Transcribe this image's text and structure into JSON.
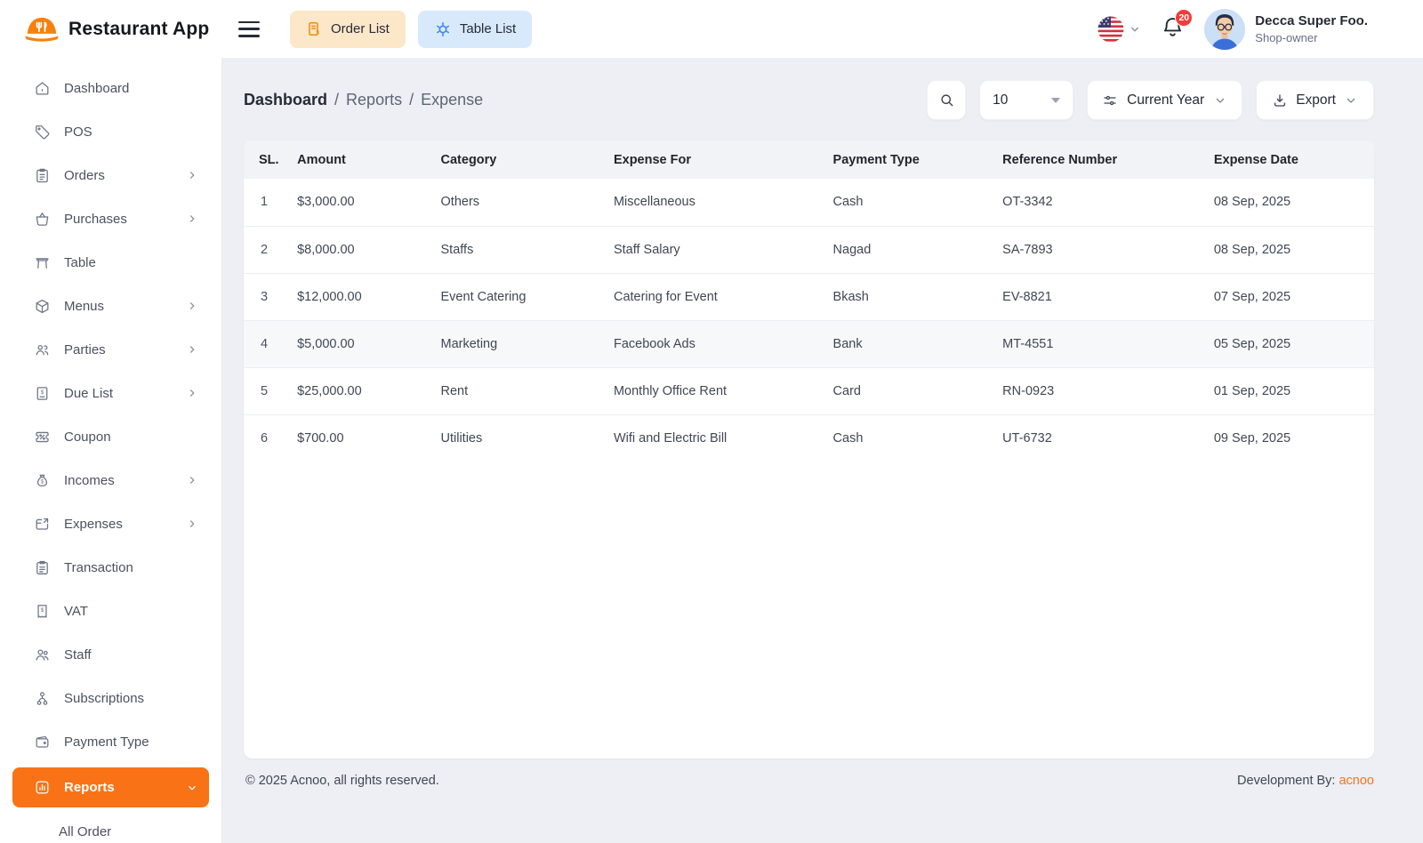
{
  "app": {
    "name": "Restaurant App"
  },
  "topbar": {
    "order_list_label": "Order List",
    "table_list_label": "Table List",
    "notification_count": "20",
    "user": {
      "name": "Decca Super Foo.",
      "role": "Shop-owner"
    }
  },
  "sidebar": {
    "items": [
      {
        "label": "Dashboard",
        "icon": "home",
        "arrow": false,
        "active": false
      },
      {
        "label": "POS",
        "icon": "tag",
        "arrow": false,
        "active": false
      },
      {
        "label": "Orders",
        "icon": "clipboard",
        "arrow": true,
        "active": false
      },
      {
        "label": "Purchases",
        "icon": "basket",
        "arrow": true,
        "active": false
      },
      {
        "label": "Table",
        "icon": "table",
        "arrow": false,
        "active": false
      },
      {
        "label": "Menus",
        "icon": "box",
        "arrow": true,
        "active": false
      },
      {
        "label": "Parties",
        "icon": "users",
        "arrow": true,
        "active": false
      },
      {
        "label": "Due List",
        "icon": "invoice",
        "arrow": true,
        "active": false
      },
      {
        "label": "Coupon",
        "icon": "coupon",
        "arrow": false,
        "active": false
      },
      {
        "label": "Incomes",
        "icon": "moneybag",
        "arrow": true,
        "active": false
      },
      {
        "label": "Expenses",
        "icon": "walletout",
        "arrow": true,
        "active": false
      },
      {
        "label": "Transaction",
        "icon": "receipt",
        "arrow": false,
        "active": false
      },
      {
        "label": "VAT",
        "icon": "vat",
        "arrow": false,
        "active": false
      },
      {
        "label": "Staff",
        "icon": "people",
        "arrow": false,
        "active": false
      },
      {
        "label": "Subscriptions",
        "icon": "subs",
        "arrow": false,
        "active": false
      },
      {
        "label": "Payment Type",
        "icon": "payment",
        "arrow": false,
        "active": false
      },
      {
        "label": "Reports",
        "icon": "chart",
        "arrow": "down",
        "active": true
      }
    ],
    "submenu_partial": "All Order"
  },
  "breadcrumb": {
    "level1": "Dashboard",
    "sep": "/",
    "level2": "Reports",
    "level3": "Expense"
  },
  "controls": {
    "page_size": "10",
    "period": "Current Year",
    "export_label": "Export"
  },
  "table": {
    "headers": [
      "SL.",
      "Amount",
      "Category",
      "Expense For",
      "Payment Type",
      "Reference Number",
      "Expense Date"
    ],
    "col_widths": [
      "4.1%",
      "12.7%",
      "15.3%",
      "19.4%",
      "15.0%",
      "18.7%",
      "14.8%"
    ],
    "rows": [
      [
        "1",
        "$3,000.00",
        "Others",
        "Miscellaneous",
        "Cash",
        "OT-3342",
        "08 Sep, 2025"
      ],
      [
        "2",
        "$8,000.00",
        "Staffs",
        "Staff Salary",
        "Nagad",
        "SA-7893",
        "08 Sep, 2025"
      ],
      [
        "3",
        "$12,000.00",
        "Event Catering",
        "Catering for Event",
        "Bkash",
        "EV-8821",
        "07 Sep, 2025"
      ],
      [
        "4",
        "$5,000.00",
        "Marketing",
        "Facebook Ads",
        "Bank",
        "MT-4551",
        "05 Sep, 2025"
      ],
      [
        "5",
        "$25,000.00",
        "Rent",
        "Monthly Office Rent",
        "Card",
        "RN-0923",
        "01 Sep, 2025"
      ],
      [
        "6",
        "$700.00",
        "Utilities",
        "Wifi and Electric Bill",
        "Cash",
        "UT-6732",
        "09 Sep, 2025"
      ]
    ],
    "highlighted_row_index": 3
  },
  "footer": {
    "copyright": "© 2025 Acnoo, all rights reserved.",
    "dev_by": "Development By:",
    "dev_link": "acnoo"
  },
  "colors": {
    "accent_orange": "#f97316",
    "badge_red": "#f43b3b",
    "order_btn_bg": "#fce7c9",
    "table_btn_bg": "#d8e9fb",
    "link_blue": "#3b82f6"
  }
}
